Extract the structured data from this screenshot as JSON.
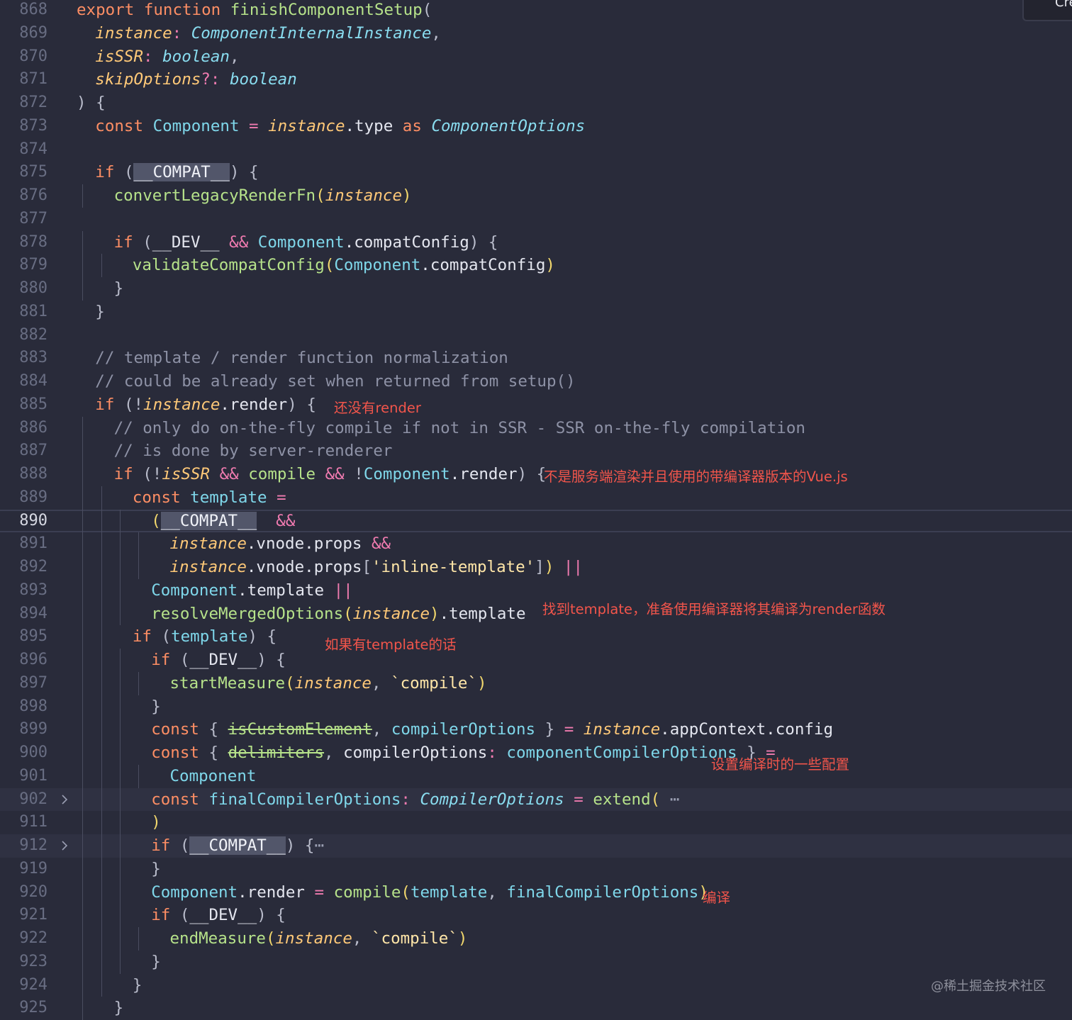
{
  "lines": [
    {
      "n": "868",
      "d": 0,
      "t": [
        [
          "k",
          "export "
        ],
        [
          "k",
          "function "
        ],
        [
          "fn",
          "finishComponentSetup"
        ],
        [
          "pu",
          "("
        ]
      ]
    },
    {
      "n": "869",
      "d": 1,
      "t": [
        [
          "it",
          "instance"
        ],
        [
          "op",
          ": "
        ],
        [
          "ty",
          "ComponentInternalInstance"
        ],
        [
          "pu",
          ","
        ]
      ]
    },
    {
      "n": "870",
      "d": 1,
      "t": [
        [
          "it",
          "isSSR"
        ],
        [
          "op",
          ": "
        ],
        [
          "ty",
          "boolean"
        ],
        [
          "pu",
          ","
        ]
      ]
    },
    {
      "n": "871",
      "d": 1,
      "t": [
        [
          "it",
          "skipOptions"
        ],
        [
          "op",
          "?: "
        ],
        [
          "ty",
          "boolean"
        ]
      ]
    },
    {
      "n": "872",
      "d": 0,
      "t": [
        [
          "pu",
          ") {"
        ]
      ]
    },
    {
      "n": "873",
      "d": 1,
      "t": [
        [
          "k",
          "const "
        ],
        [
          "cl",
          "Component"
        ],
        [
          "op",
          " = "
        ],
        [
          "it",
          "instance"
        ],
        [
          "pr",
          ".type "
        ],
        [
          "k",
          "as "
        ],
        [
          "ty",
          "ComponentOptions"
        ]
      ]
    },
    {
      "n": "874",
      "d": 0,
      "t": []
    },
    {
      "n": "875",
      "d": 1,
      "t": [
        [
          "k",
          "if "
        ],
        [
          "pu",
          "("
        ],
        [
          "hl",
          "__COMPAT__"
        ],
        [
          "pu",
          ") {"
        ]
      ]
    },
    {
      "n": "876",
      "d": 2,
      "t": [
        [
          "fn",
          "convertLegacyRenderFn"
        ],
        [
          "br",
          "("
        ],
        [
          "it",
          "instance"
        ],
        [
          "br",
          ")"
        ]
      ]
    },
    {
      "n": "877",
      "d": 0,
      "t": []
    },
    {
      "n": "878",
      "d": 2,
      "t": [
        [
          "k",
          "if "
        ],
        [
          "pu",
          "("
        ],
        [
          "v",
          "__DEV__"
        ],
        [
          "op",
          " && "
        ],
        [
          "cl",
          "Component"
        ],
        [
          "pr",
          ".compatConfig"
        ],
        [
          "pu",
          ") {"
        ]
      ]
    },
    {
      "n": "879",
      "d": 3,
      "t": [
        [
          "fn",
          "validateCompatConfig"
        ],
        [
          "br",
          "("
        ],
        [
          "cl",
          "Component"
        ],
        [
          "pr",
          ".compatConfig"
        ],
        [
          "br",
          ")"
        ]
      ]
    },
    {
      "n": "880",
      "d": 2,
      "t": [
        [
          "pu",
          "}"
        ]
      ]
    },
    {
      "n": "881",
      "d": 1,
      "t": [
        [
          "pu",
          "}"
        ]
      ]
    },
    {
      "n": "882",
      "d": 0,
      "t": []
    },
    {
      "n": "883",
      "d": 1,
      "t": [
        [
          "cm",
          "// template / render function normalization"
        ]
      ]
    },
    {
      "n": "884",
      "d": 1,
      "t": [
        [
          "cm",
          "// could be already set when returned from setup()"
        ]
      ]
    },
    {
      "n": "885",
      "d": 1,
      "t": [
        [
          "k",
          "if "
        ],
        [
          "pu",
          "(!"
        ],
        [
          "it",
          "instance"
        ],
        [
          "pr",
          ".render"
        ],
        [
          "pu",
          ") {"
        ]
      ]
    },
    {
      "n": "886",
      "d": 2,
      "t": [
        [
          "cm",
          "// only do on-the-fly compile if not in SSR - SSR on-the-fly compilation"
        ]
      ]
    },
    {
      "n": "887",
      "d": 2,
      "t": [
        [
          "cm",
          "// is done by server-renderer"
        ]
      ]
    },
    {
      "n": "888",
      "d": 2,
      "t": [
        [
          "k",
          "if "
        ],
        [
          "pu",
          "(!"
        ],
        [
          "it",
          "isSSR"
        ],
        [
          "op",
          " && "
        ],
        [
          "fn",
          "compile"
        ],
        [
          "op",
          " && "
        ],
        [
          "pu",
          "!"
        ],
        [
          "cl",
          "Component"
        ],
        [
          "pr",
          ".render"
        ],
        [
          "pu",
          ") {"
        ]
      ]
    },
    {
      "n": "889",
      "d": 3,
      "t": [
        [
          "k",
          "const "
        ],
        [
          "cl",
          "template"
        ],
        [
          "op",
          " ="
        ]
      ]
    },
    {
      "n": "890",
      "d": 4,
      "t": [
        [
          "br",
          "("
        ],
        [
          "hl",
          "__COMPAT__"
        ],
        [
          "op",
          "  &&"
        ]
      ],
      "current": true
    },
    {
      "n": "891",
      "d": 5,
      "t": [
        [
          "it",
          "instance"
        ],
        [
          "pr",
          ".vnode.props "
        ],
        [
          "op",
          "&&"
        ]
      ]
    },
    {
      "n": "892",
      "d": 5,
      "t": [
        [
          "it",
          "instance"
        ],
        [
          "pr",
          ".vnode.props"
        ],
        [
          "pu",
          "["
        ],
        [
          "str",
          "'inline-template'"
        ],
        [
          "pu",
          "]"
        ],
        [
          "br",
          ")"
        ],
        [
          "op",
          " ||"
        ]
      ]
    },
    {
      "n": "893",
      "d": 4,
      "t": [
        [
          "cl",
          "Component"
        ],
        [
          "pr",
          ".template "
        ],
        [
          "op",
          "||"
        ]
      ]
    },
    {
      "n": "894",
      "d": 4,
      "t": [
        [
          "fn",
          "resolveMergedOptions"
        ],
        [
          "br",
          "("
        ],
        [
          "it",
          "instance"
        ],
        [
          "br",
          ")"
        ],
        [
          "pr",
          ".template"
        ]
      ]
    },
    {
      "n": "895",
      "d": 3,
      "t": [
        [
          "k",
          "if "
        ],
        [
          "pu",
          "("
        ],
        [
          "cl",
          "template"
        ],
        [
          "pu",
          ") {"
        ]
      ]
    },
    {
      "n": "896",
      "d": 4,
      "t": [
        [
          "k",
          "if "
        ],
        [
          "pu",
          "("
        ],
        [
          "v",
          "__DEV__"
        ],
        [
          "pu",
          ") {"
        ]
      ]
    },
    {
      "n": "897",
      "d": 5,
      "t": [
        [
          "fn",
          "startMeasure"
        ],
        [
          "br",
          "("
        ],
        [
          "it",
          "instance"
        ],
        [
          "pu",
          ", "
        ],
        [
          "str",
          "`compile`"
        ],
        [
          "br",
          ")"
        ]
      ]
    },
    {
      "n": "898",
      "d": 4,
      "t": [
        [
          "pu",
          "}"
        ]
      ]
    },
    {
      "n": "899",
      "d": 4,
      "t": [
        [
          "k",
          "const "
        ],
        [
          "pu",
          "{ "
        ],
        [
          "fn st",
          "isCustomElement"
        ],
        [
          "pu",
          ", "
        ],
        [
          "cl",
          "compilerOptions"
        ],
        [
          "pu",
          " } "
        ],
        [
          "op",
          "= "
        ],
        [
          "it",
          "instance"
        ],
        [
          "pr",
          ".appContext.config"
        ]
      ]
    },
    {
      "n": "900",
      "d": 4,
      "t": [
        [
          "k",
          "const "
        ],
        [
          "pu",
          "{ "
        ],
        [
          "fn st",
          "delimiters"
        ],
        [
          "pu",
          ", "
        ],
        [
          "pr",
          "compilerOptions"
        ],
        [
          "op",
          ": "
        ],
        [
          "cl",
          "componentCompilerOptions"
        ],
        [
          "pu",
          " } "
        ],
        [
          "op",
          "="
        ]
      ]
    },
    {
      "n": "901",
      "d": 5,
      "t": [
        [
          "cl",
          "Component"
        ]
      ]
    },
    {
      "n": "902",
      "d": 4,
      "t": [
        [
          "k",
          "const "
        ],
        [
          "cl",
          "finalCompilerOptions"
        ],
        [
          "op",
          ": "
        ],
        [
          "ty",
          "CompilerOptions"
        ],
        [
          "op",
          " = "
        ],
        [
          "fn",
          "extend"
        ],
        [
          "br",
          "("
        ],
        [
          "ell",
          " ⋯"
        ]
      ],
      "fold": true
    },
    {
      "n": "911",
      "d": 4,
      "t": [
        [
          "br",
          ")"
        ]
      ]
    },
    {
      "n": "912",
      "d": 4,
      "t": [
        [
          "k",
          "if "
        ],
        [
          "pu",
          "("
        ],
        [
          "hl",
          "__COMPAT__"
        ],
        [
          "pu",
          ") {"
        ],
        [
          "ell",
          "⋯"
        ]
      ],
      "fold": true
    },
    {
      "n": "919",
      "d": 4,
      "t": [
        [
          "pu",
          "}"
        ]
      ]
    },
    {
      "n": "920",
      "d": 4,
      "t": [
        [
          "cl",
          "Component"
        ],
        [
          "pr",
          ".render "
        ],
        [
          "op",
          "= "
        ],
        [
          "fn",
          "compile"
        ],
        [
          "br",
          "("
        ],
        [
          "cl",
          "template"
        ],
        [
          "pu",
          ", "
        ],
        [
          "cl",
          "finalCompilerOptions"
        ],
        [
          "br",
          ")"
        ]
      ]
    },
    {
      "n": "921",
      "d": 4,
      "t": [
        [
          "k",
          "if "
        ],
        [
          "pu",
          "("
        ],
        [
          "v",
          "__DEV__"
        ],
        [
          "pu",
          ") {"
        ]
      ]
    },
    {
      "n": "922",
      "d": 5,
      "t": [
        [
          "fn",
          "endMeasure"
        ],
        [
          "br",
          "("
        ],
        [
          "it",
          "instance"
        ],
        [
          "pu",
          ", "
        ],
        [
          "str",
          "`compile`"
        ],
        [
          "br",
          ")"
        ]
      ]
    },
    {
      "n": "923",
      "d": 4,
      "t": [
        [
          "pu",
          "}"
        ]
      ]
    },
    {
      "n": "924",
      "d": 3,
      "t": [
        [
          "pu",
          "}"
        ]
      ]
    },
    {
      "n": "925",
      "d": 2,
      "t": [
        [
          "pu",
          "}"
        ]
      ]
    }
  ],
  "annotations": [
    {
      "text": "还没有render",
      "row": 17
    },
    {
      "text": "不是服务端渲染并且使用的带编译器版本的Vue.js",
      "row": 20
    },
    {
      "text": "找到template，准备使用编译器将其编译为render函数",
      "row": 26
    },
    {
      "text": "如果有template的话",
      "row": 27
    },
    {
      "text": "设置编译时的一些配置",
      "row": 33
    },
    {
      "text": "编译",
      "row": 38
    }
  ],
  "watermark": "@稀土掘金技术社区",
  "corner_label": "Cre"
}
